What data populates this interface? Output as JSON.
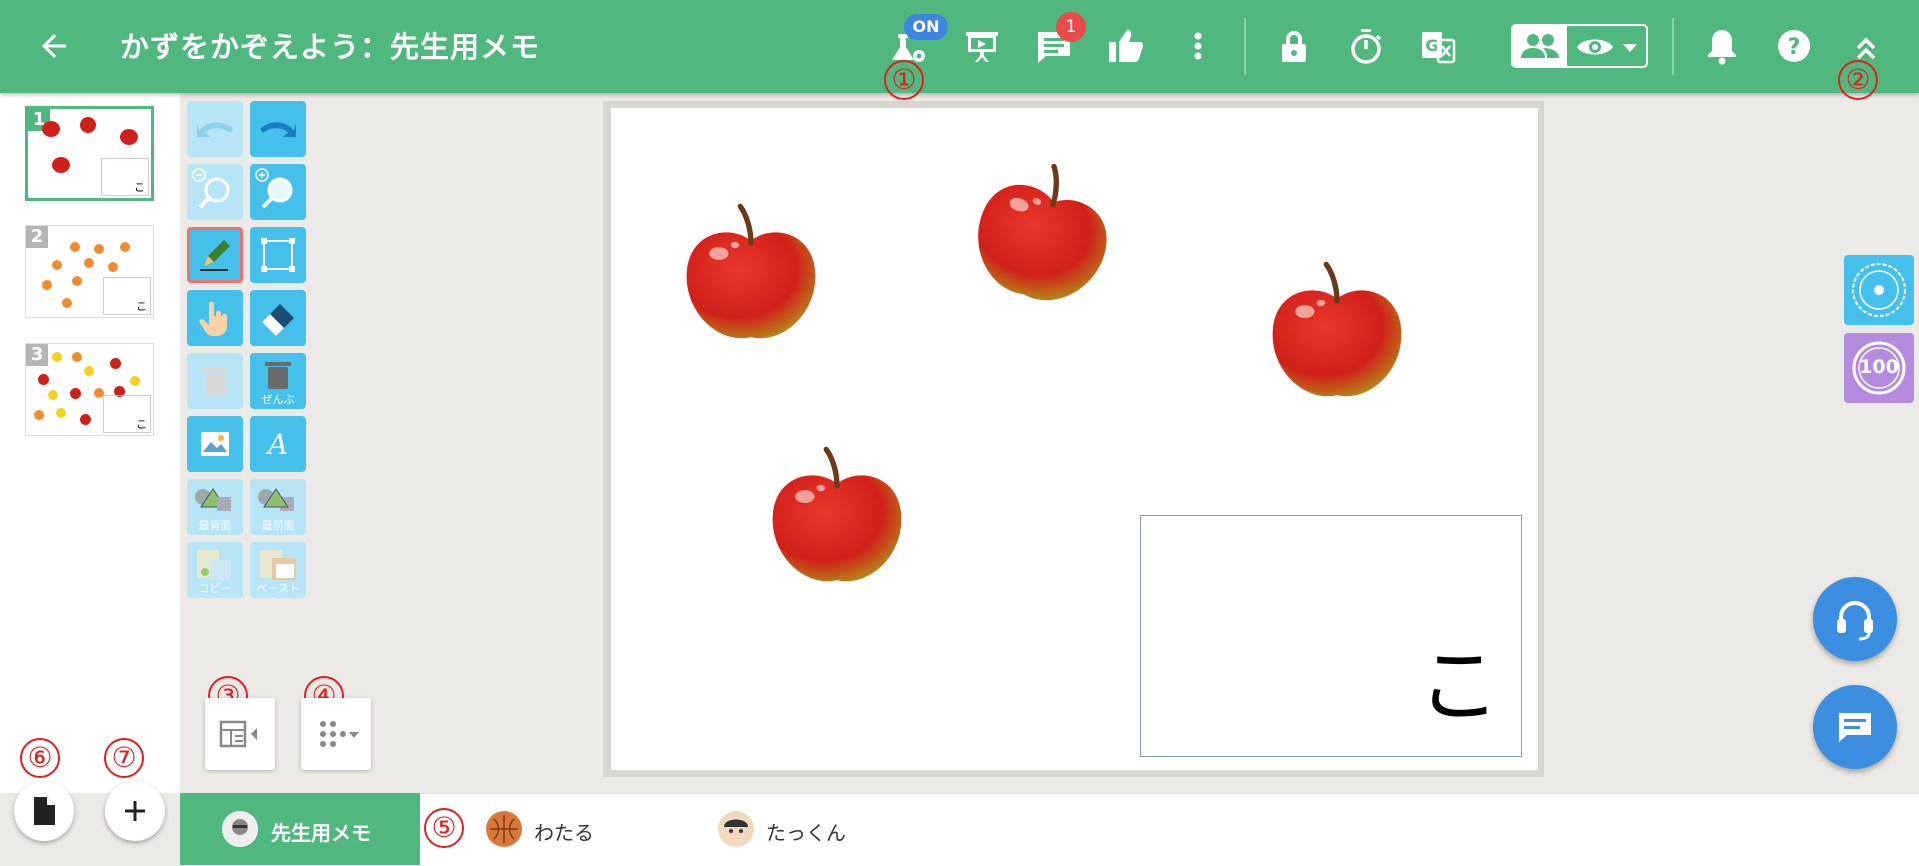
{
  "header": {
    "title": "かずをかぞえよう：先生用メモ",
    "on_badge": "ON",
    "message_count": "1",
    "background": "#50b87e"
  },
  "annotations": {
    "n1": "①",
    "n2": "②",
    "n3": "③",
    "n4": "④",
    "n5": "⑤",
    "n6": "⑥",
    "n7": "⑦"
  },
  "thumbnails": [
    {
      "number": "1",
      "label": "こ",
      "selected": true
    },
    {
      "number": "2",
      "label": "こ",
      "selected": false
    },
    {
      "number": "3",
      "label": "こ",
      "selected": false
    }
  ],
  "tools": {
    "delete_all_label": "ぜんぶ",
    "send_back_label": "最背面",
    "bring_front_label": "最前面",
    "copy_label": "コピー",
    "paste_label": "ペースト"
  },
  "canvas": {
    "answer_text": "こ"
  },
  "students": [
    {
      "name": "先生用メモ"
    },
    {
      "name": "わたる"
    },
    {
      "name": "たっくん"
    }
  ],
  "side_buttons": {
    "score_label": "100"
  },
  "icons": [
    "arrow-left-icon",
    "flask-gear-icon",
    "presentation-icon",
    "chat-icon",
    "thumbs-up-icon",
    "more-vert-icon",
    "lock-icon",
    "timer-icon",
    "translate-off-icon",
    "people-icon",
    "eye-icon",
    "bell-icon",
    "help-icon",
    "chevron-double-up-icon",
    "undo-icon",
    "redo-icon",
    "zoom-out-icon",
    "zoom-in-icon",
    "pencil-icon",
    "select-rect-icon",
    "hand-icon",
    "eraser-icon",
    "trash-icon",
    "image-icon",
    "text-icon",
    "layer-back-icon",
    "layer-front-icon",
    "copy-icon",
    "paste-icon",
    "layout-panel-icon",
    "dots-menu-icon",
    "headset-icon",
    "message-icon",
    "file-icon",
    "plus-icon",
    "stamp-icon"
  ],
  "colors": {
    "accent": "#50b87e",
    "tool_blue": "#45c0ea",
    "badge_red": "#e94a4a",
    "badge_blue": "#3e85e0",
    "fab_blue": "#3b8ee0",
    "score_purple": "#b58be0"
  }
}
